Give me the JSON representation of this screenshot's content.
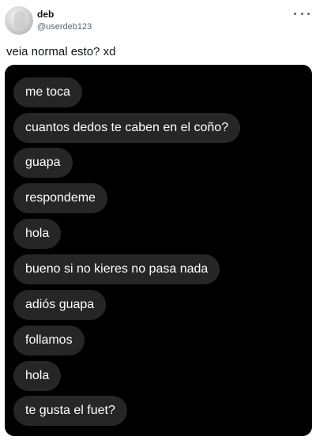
{
  "tweet": {
    "author": {
      "display_name": "deb",
      "handle": "@userdeb123"
    },
    "text": "veia normal esto? xd",
    "more_icon": "more-horizontal-icon"
  },
  "chat": {
    "background_color": "#000000",
    "bubble_color": "#262626",
    "text_color": "#ffffff",
    "messages": [
      "me toca",
      "cuantos dedos te caben en el coño?",
      "guapa",
      "respondeme",
      "hola",
      "bueno si no kieres no pasa nada",
      "adiós guapa",
      "follamos",
      "hola",
      "te gusta el fuet?"
    ]
  }
}
